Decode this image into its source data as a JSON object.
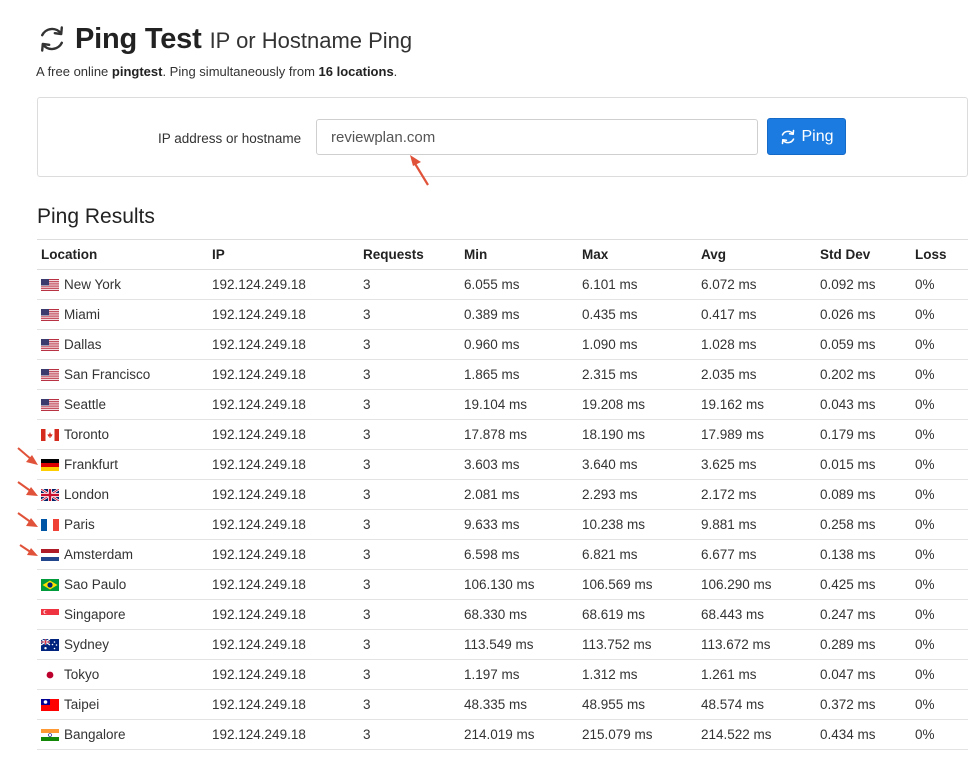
{
  "header": {
    "title": "Ping Test",
    "title_sub": "IP or Hostname Ping",
    "subtitle_pre": "A free online ",
    "subtitle_bold1": "pingtest",
    "subtitle_mid": ". Ping simultaneously from ",
    "subtitle_bold2": "16 locations",
    "subtitle_post": "."
  },
  "form": {
    "label": "IP address or hostname",
    "input_value": "reviewplan.com",
    "button_label": "Ping"
  },
  "results": {
    "heading": "Ping Results",
    "columns": [
      "Location",
      "IP",
      "Requests",
      "Min",
      "Max",
      "Avg",
      "Std Dev",
      "Loss"
    ],
    "rows": [
      {
        "flag": "us",
        "location": "New York",
        "ip": "192.124.249.18",
        "requests": "3",
        "min": "6.055 ms",
        "max": "6.101 ms",
        "avg": "6.072 ms",
        "stddev": "0.092 ms",
        "loss": "0%"
      },
      {
        "flag": "us",
        "location": "Miami",
        "ip": "192.124.249.18",
        "requests": "3",
        "min": "0.389 ms",
        "max": "0.435 ms",
        "avg": "0.417 ms",
        "stddev": "0.026 ms",
        "loss": "0%"
      },
      {
        "flag": "us",
        "location": "Dallas",
        "ip": "192.124.249.18",
        "requests": "3",
        "min": "0.960 ms",
        "max": "1.090 ms",
        "avg": "1.028 ms",
        "stddev": "0.059 ms",
        "loss": "0%"
      },
      {
        "flag": "us",
        "location": "San Francisco",
        "ip": "192.124.249.18",
        "requests": "3",
        "min": "1.865 ms",
        "max": "2.315 ms",
        "avg": "2.035 ms",
        "stddev": "0.202 ms",
        "loss": "0%"
      },
      {
        "flag": "us",
        "location": "Seattle",
        "ip": "192.124.249.18",
        "requests": "3",
        "min": "19.104 ms",
        "max": "19.208 ms",
        "avg": "19.162 ms",
        "stddev": "0.043 ms",
        "loss": "0%"
      },
      {
        "flag": "ca",
        "location": "Toronto",
        "ip": "192.124.249.18",
        "requests": "3",
        "min": "17.878 ms",
        "max": "18.190 ms",
        "avg": "17.989 ms",
        "stddev": "0.179 ms",
        "loss": "0%"
      },
      {
        "flag": "de",
        "location": "Frankfurt",
        "ip": "192.124.249.18",
        "requests": "3",
        "min": "3.603 ms",
        "max": "3.640 ms",
        "avg": "3.625 ms",
        "stddev": "0.015 ms",
        "loss": "0%"
      },
      {
        "flag": "gb",
        "location": "London",
        "ip": "192.124.249.18",
        "requests": "3",
        "min": "2.081 ms",
        "max": "2.293 ms",
        "avg": "2.172 ms",
        "stddev": "0.089 ms",
        "loss": "0%"
      },
      {
        "flag": "fr",
        "location": "Paris",
        "ip": "192.124.249.18",
        "requests": "3",
        "min": "9.633 ms",
        "max": "10.238 ms",
        "avg": "9.881 ms",
        "stddev": "0.258 ms",
        "loss": "0%"
      },
      {
        "flag": "nl",
        "location": "Amsterdam",
        "ip": "192.124.249.18",
        "requests": "3",
        "min": "6.598 ms",
        "max": "6.821 ms",
        "avg": "6.677 ms",
        "stddev": "0.138 ms",
        "loss": "0%"
      },
      {
        "flag": "br",
        "location": "Sao Paulo",
        "ip": "192.124.249.18",
        "requests": "3",
        "min": "106.130 ms",
        "max": "106.569 ms",
        "avg": "106.290 ms",
        "stddev": "0.425 ms",
        "loss": "0%"
      },
      {
        "flag": "sg",
        "location": "Singapore",
        "ip": "192.124.249.18",
        "requests": "3",
        "min": "68.330 ms",
        "max": "68.619 ms",
        "avg": "68.443 ms",
        "stddev": "0.247 ms",
        "loss": "0%"
      },
      {
        "flag": "au",
        "location": "Sydney",
        "ip": "192.124.249.18",
        "requests": "3",
        "min": "113.549 ms",
        "max": "113.752 ms",
        "avg": "113.672 ms",
        "stddev": "0.289 ms",
        "loss": "0%"
      },
      {
        "flag": "jp",
        "location": "Tokyo",
        "ip": "192.124.249.18",
        "requests": "3",
        "min": "1.197 ms",
        "max": "1.312 ms",
        "avg": "1.261 ms",
        "stddev": "0.047 ms",
        "loss": "0%"
      },
      {
        "flag": "tw",
        "location": "Taipei",
        "ip": "192.124.249.18",
        "requests": "3",
        "min": "48.335 ms",
        "max": "48.955 ms",
        "avg": "48.574 ms",
        "stddev": "0.372 ms",
        "loss": "0%"
      },
      {
        "flag": "in",
        "location": "Bangalore",
        "ip": "192.124.249.18",
        "requests": "3",
        "min": "214.019 ms",
        "max": "215.079 ms",
        "avg": "214.522 ms",
        "stddev": "0.434 ms",
        "loss": "0%"
      }
    ]
  },
  "colors": {
    "button_bg": "#1b7be0",
    "annotation_arrow": "#e0533a"
  },
  "icons": {
    "title_icon": "refresh-icon",
    "button_icon": "refresh-icon"
  }
}
